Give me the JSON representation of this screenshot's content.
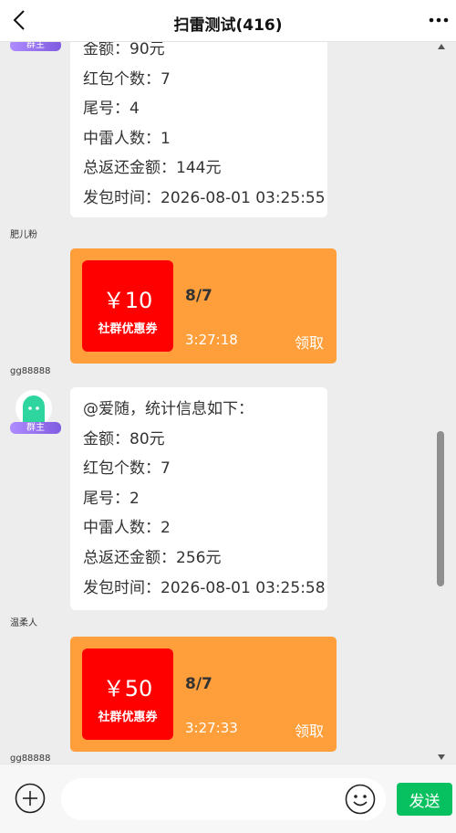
{
  "header": {
    "title": "扫雷测试(416)"
  },
  "messages": [
    {
      "owner_tag": "群主",
      "lines": [
        "金额：90元",
        "红包个数：7",
        "尾号：4",
        "中雷人数：1",
        "总返还金额：144元",
        "发包时间：2026-08-01 03:25:55"
      ]
    },
    {
      "nick": "肥儿粉",
      "coupon": {
        "amount": "￥10",
        "label": "社群优惠券",
        "count": "8/7",
        "time": "3:27:18",
        "claim": "领取"
      }
    },
    {
      "nick": "gg88888",
      "owner_tag": "群主",
      "lines": [
        "@爱随，统计信息如下：",
        "金额：80元",
        "红包个数：7",
        "尾号：2",
        "中雷人数：2",
        "总返还金额：256元",
        "发包时间：2026-08-01 03:25:58"
      ]
    },
    {
      "nick": "温柔人",
      "coupon": {
        "amount": "￥50",
        "label": "社群优惠券",
        "count": "8/7",
        "time": "3:27:33",
        "claim": "领取"
      }
    },
    {
      "nick": "gg88888"
    }
  ],
  "input": {
    "placeholder": "",
    "send_label": "发送"
  },
  "colors": {
    "coupon_bg": "#ff9f3b",
    "coupon_red": "#ff0000",
    "send_green": "#07c160",
    "owner_tag": "#8e6ae8"
  }
}
